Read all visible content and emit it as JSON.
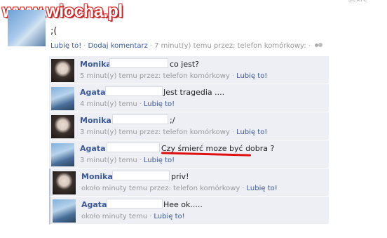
{
  "watermark": "www.wiocha.pl",
  "topright": "sekre",
  "status": {
    "text": ";(",
    "like": "Lubię to!",
    "comment": "Dodaj komentarz",
    "time": "7 minut(y) temu przez: telefon komórkowy:"
  },
  "comments": [
    {
      "name": "Monika",
      "text": "co jest?",
      "time": "5 minut(y) temu przez: telefon komórkowy",
      "like": "Lubię to!"
    },
    {
      "name": "Agata",
      "text": "Jest tragedia ....",
      "time": "4 minut(y) temu",
      "like": "Lubię to!"
    },
    {
      "name": "Monika",
      "text": ";/",
      "time": "3 minut(y) temu przez: telefon komórkowy",
      "like": "Lubię to!"
    },
    {
      "name": "Agata",
      "text": "Czy śmierć moze być dobra ?",
      "time": "3 minut(y) temu",
      "like": "Lubię to!"
    },
    {
      "name": "Monika",
      "text": "priv!",
      "time": "około minuty temu przez: telefon komórkowy",
      "like": "Lubię to!"
    },
    {
      "name": "Agata",
      "text": "Hee ok.....",
      "time": "około minuty temu",
      "like": "Lubię to!"
    }
  ],
  "colors": {
    "link": "#3b5998",
    "comment_bg": "#edeff4",
    "meta": "#999999",
    "highlight": "#e01010"
  }
}
